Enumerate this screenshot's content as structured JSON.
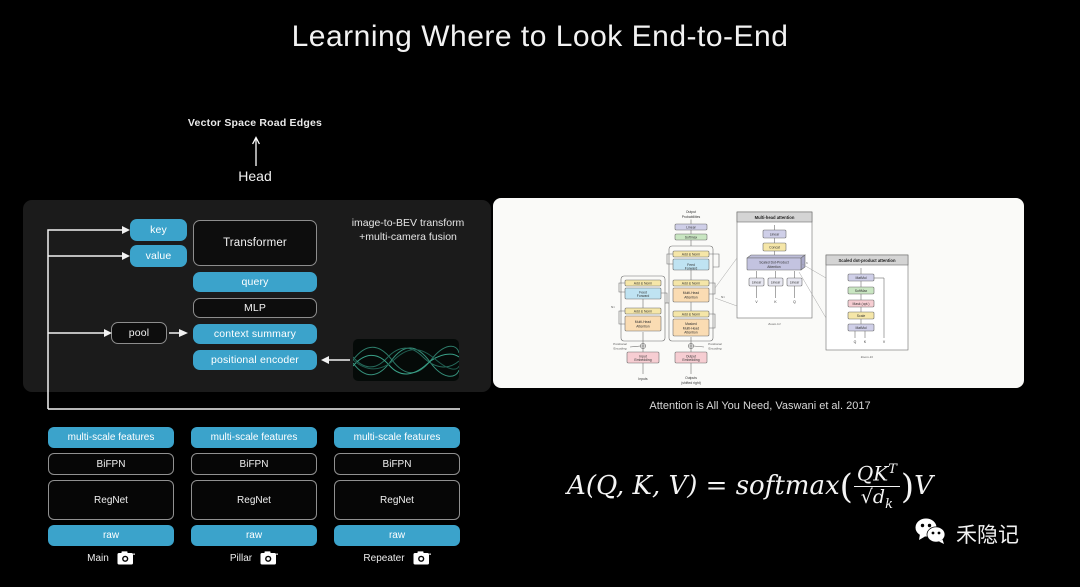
{
  "slide": {
    "title": "Learning Where to Look End-to-End",
    "background_color": "#000000",
    "accent_blue": "#3ba3cb",
    "panel_dark": "#1b1b1b",
    "panel_light": "#fafaf8"
  },
  "output_head": {
    "top_label": "Vector Space Road Edges",
    "arrow_icon": "up-arrow-icon",
    "head_label": "Head"
  },
  "fusion_panel": {
    "note_line_1": "image-to-BEV transform",
    "note_line_2": "+multi-camera fusion",
    "blocks": {
      "key": "key",
      "value": "value",
      "transformer": "Transformer",
      "query": "query",
      "mlp": "MLP",
      "context_summary": "context summary",
      "positional_encoder": "positional encoder",
      "pool": "pool"
    },
    "wave_thumbnail": "sinusoid-waveform-icon"
  },
  "camera_columns": [
    {
      "camera_name": "Main",
      "camera_icon": "camera-icon",
      "stack": [
        "multi-scale features",
        "BiFPN",
        "RegNet",
        "raw"
      ]
    },
    {
      "camera_name": "Pillar",
      "camera_icon": "camera-icon",
      "stack": [
        "multi-scale features",
        "BiFPN",
        "RegNet",
        "raw"
      ]
    },
    {
      "camera_name": "Repeater",
      "camera_icon": "camera-icon",
      "stack": [
        "multi-scale features",
        "BiFPN",
        "RegNet",
        "raw"
      ]
    }
  ],
  "reference_figure": {
    "caption": "Attention is All You Need, Vaswani et al. 2017",
    "main_diagram": {
      "top_label_line1": "Output",
      "top_label_line2": "Probabilities",
      "softmax": "Softmax",
      "linear": "Linear",
      "encoder_blocks": [
        "Add & Norm",
        "Feed Forward",
        "Add & Norm",
        "Multi-Head Attention"
      ],
      "decoder_blocks": [
        "Add & Norm",
        "Feed Forward",
        "Add & Norm",
        "Multi-Head Attention",
        "Add & Norm",
        "Masked Multi-Head Attention"
      ],
      "n_label_left": "N×",
      "n_label_right": "N×",
      "pos_enc_left_l1": "Positional",
      "pos_enc_left_l2": "Encoding",
      "pos_enc_right_l1": "Positional",
      "pos_enc_right_l2": "Encoding",
      "input_embedding": "Input Embedding",
      "output_embedding": "Output Embedding",
      "inputs": "Inputs",
      "outputs_l1": "Outputs",
      "outputs_l2": "(shifted right)"
    },
    "inset_multihead": {
      "title": "Multi-head attention",
      "blocks": [
        "Linear",
        "Concat",
        "Scaled Dot-Product Attention",
        "Linear",
        "Linear",
        "Linear"
      ],
      "inputs": [
        "V",
        "K",
        "Q"
      ],
      "zoom_label": "Zoom-In!",
      "h_label": "h"
    },
    "inset_scaled": {
      "title": "Scaled dot-product attention",
      "blocks": [
        "MatMul",
        "SoftMax",
        "Mask (opt.)",
        "Scale",
        "MatMul"
      ],
      "inputs": [
        "Q",
        "K",
        "V"
      ],
      "zoom_label": "Zoom-In!"
    }
  },
  "attention_formula": {
    "lhs": "A(Q, K, V) =",
    "func": "softmax",
    "numerator": "QK",
    "numerator_sup": "T",
    "denominator_radical": "√",
    "denominator": "d",
    "denominator_sub": "k",
    "trailing": "V"
  },
  "watermark": {
    "icon": "wechat-logo-icon",
    "text": "禾隐记"
  }
}
